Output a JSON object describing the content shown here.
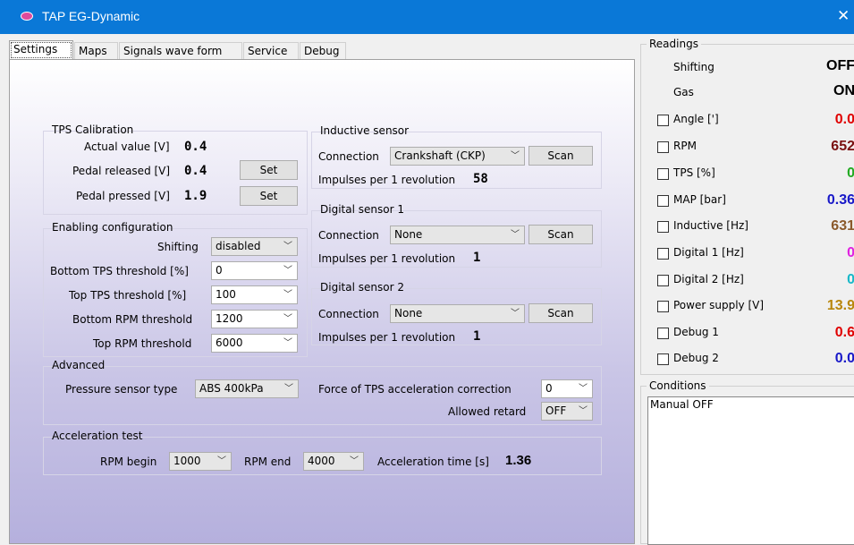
{
  "window": {
    "title": "TAP EG-Dynamic",
    "close": "✕"
  },
  "tabs": [
    "Settings",
    "Maps",
    "Signals wave form",
    "Service",
    "Debug"
  ],
  "tps": {
    "title": "TPS Calibration",
    "actual_label": "Actual value [V]",
    "actual_value": "0.4",
    "released_label": "Pedal released [V]",
    "released_value": "0.4",
    "pressed_label": "Pedal pressed [V]",
    "pressed_value": "1.9",
    "set_label": "Set"
  },
  "enabling": {
    "title": "Enabling configuration",
    "rows": [
      {
        "label": "Shifting",
        "value": "disabled"
      },
      {
        "label": "Bottom TPS threshold [%]",
        "value": "0"
      },
      {
        "label": "Top TPS threshold [%]",
        "value": "100"
      },
      {
        "label": "Bottom RPM threshold",
        "value": "1200"
      },
      {
        "label": "Top RPM threshold",
        "value": "6000"
      }
    ]
  },
  "inductive": {
    "title": "Inductive sensor",
    "connection_label": "Connection",
    "connection_value": "Crankshaft (CKP)",
    "scan_label": "Scan",
    "impulses_label": "Impulses per 1 revolution",
    "impulses_value": "58"
  },
  "digital1": {
    "title": "Digital sensor 1",
    "connection_label": "Connection",
    "connection_value": "None",
    "scan_label": "Scan",
    "impulses_label": "Impulses per 1 revolution",
    "impulses_value": "1"
  },
  "digital2": {
    "title": "Digital sensor 2",
    "connection_label": "Connection",
    "connection_value": "None",
    "scan_label": "Scan",
    "impulses_label": "Impulses per 1 revolution",
    "impulses_value": "1"
  },
  "advanced": {
    "title": "Advanced",
    "pressure_label": "Pressure sensor type",
    "pressure_value": "ABS 400kPa",
    "force_label": "Force of TPS acceleration correction",
    "force_value": "0",
    "retard_label": "Allowed retard",
    "retard_value": "OFF"
  },
  "accel": {
    "title": "Acceleration test",
    "rpm_begin_label": "RPM begin",
    "rpm_begin_value": "1000",
    "rpm_end_label": "RPM end",
    "rpm_end_value": "4000",
    "time_label": "Acceleration time [s]",
    "time_value": "1.36"
  },
  "readings": {
    "title": "Readings",
    "rows": [
      {
        "label": "Shifting",
        "value": "OFF",
        "color": "#000000",
        "checkbox": false
      },
      {
        "label": "Gas",
        "value": "ON",
        "color": "#000000",
        "checkbox": false
      },
      {
        "label": "Angle [']",
        "value": "0.0",
        "color": "#e00000",
        "checkbox": true
      },
      {
        "label": "RPM",
        "value": "652",
        "color": "#7a1010",
        "checkbox": true
      },
      {
        "label": "TPS [%]",
        "value": "0",
        "color": "#22aa22",
        "checkbox": true
      },
      {
        "label": "MAP [bar]",
        "value": "0.36",
        "color": "#1818c8",
        "checkbox": true
      },
      {
        "label": "Inductive [Hz]",
        "value": "631",
        "color": "#8b5a2b",
        "checkbox": true
      },
      {
        "label": "Digital 1 [Hz]",
        "value": "0",
        "color": "#e020e0",
        "checkbox": true
      },
      {
        "label": "Digital 2 [Hz]",
        "value": "0",
        "color": "#18b8c8",
        "checkbox": true
      },
      {
        "label": "Power supply [V]",
        "value": "13.9",
        "color": "#b8860b",
        "checkbox": true
      },
      {
        "label": "Debug 1",
        "value": "0.6",
        "color": "#e00000",
        "checkbox": true
      },
      {
        "label": "Debug 2",
        "value": "0.0",
        "color": "#1818c8",
        "checkbox": true
      }
    ]
  },
  "conditions": {
    "title": "Conditions",
    "text": "Manual OFF"
  }
}
